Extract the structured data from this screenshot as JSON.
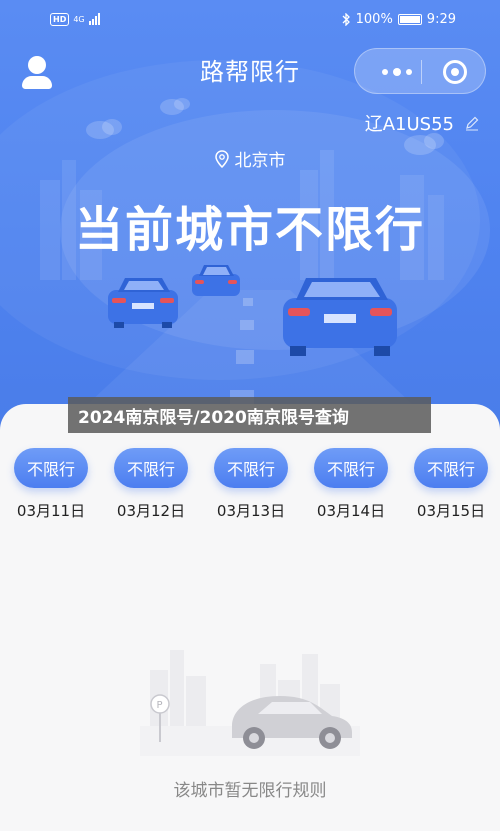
{
  "status_bar": {
    "left_badge": "HD",
    "network": "4G",
    "bluetooth_icon": "bluetooth-icon",
    "battery_text": "100%",
    "time": "9:29"
  },
  "nav": {
    "title": "路帮限行",
    "avatar_icon": "user-icon",
    "more_icon": "more-dots-icon",
    "close_icon": "target-icon"
  },
  "plate": {
    "number": "辽A1US55",
    "edit_icon": "pencil-icon"
  },
  "city": {
    "pin_icon": "location-pin-icon",
    "name": "北京市"
  },
  "headline": "当前城市不限行",
  "overlay_caption": "2024南京限号/2020南京限号查询",
  "days": [
    {
      "status": "不限行",
      "date": "03月11日"
    },
    {
      "status": "不限行",
      "date": "03月12日"
    },
    {
      "status": "不限行",
      "date": "03月13日"
    },
    {
      "status": "不限行",
      "date": "03月14日"
    },
    {
      "status": "不限行",
      "date": "03月15日"
    }
  ],
  "empty_state": {
    "message": "该城市暂无限行规则",
    "illustration_icon": "parked-car-illustration"
  },
  "colors": {
    "accent": "#4f83f0",
    "pill_top": "#6f9cf7",
    "pill_bottom": "#4c7ef0",
    "background": "#f7f7f8",
    "muted_text": "#888888"
  }
}
